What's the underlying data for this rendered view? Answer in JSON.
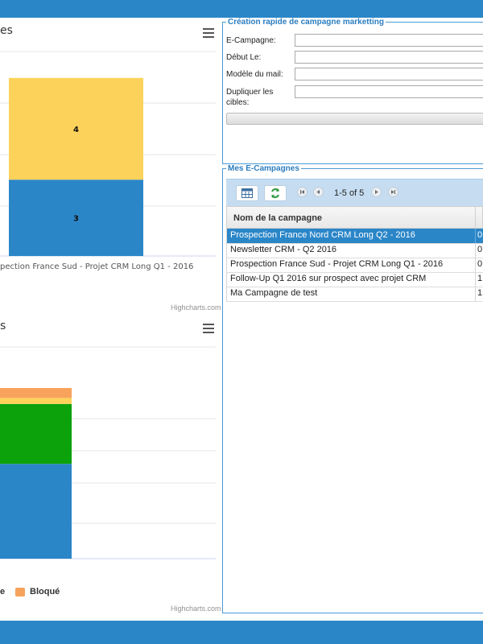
{
  "chart1": {
    "title_fragment": "es",
    "x_label": "pection France Sud - Projet CRM Long Q1 - 2016",
    "credits": "Highcharts.com",
    "menu_icon": "hamburger-menu-icon"
  },
  "chart2": {
    "title_fragment": "s",
    "credits": "Highcharts.com",
    "menu_icon": "hamburger-menu-icon",
    "legend": [
      {
        "label": "e",
        "color": null
      },
      {
        "label": "Bloqué",
        "color": "#f7a35c"
      }
    ]
  },
  "chart_data": [
    {
      "type": "bar",
      "stacked": true,
      "categories": [
        "pection France Sud - Projet CRM Long Q1 - 2016"
      ],
      "series": [
        {
          "values": [
            3
          ],
          "color": "#2b86c8"
        },
        {
          "values": [
            4
          ],
          "color": "#fdd25a"
        }
      ],
      "credits": "Highcharts.com"
    },
    {
      "type": "bar",
      "stacked": true,
      "series": [
        {
          "values": [
            9.5
          ],
          "color": "#2b86c8"
        },
        {
          "values": [
            6
          ],
          "color": "#0ba20b"
        },
        {
          "values": [
            0.6
          ],
          "color": "#fdd25a"
        },
        {
          "name": "Bloqué",
          "values": [
            1
          ],
          "color": "#f7a35c"
        }
      ],
      "credits": "Highcharts.com"
    }
  ],
  "quick_create": {
    "legend": "Création rapide de campagne marketting",
    "fields": [
      {
        "label": "E-Campagne:",
        "value": ""
      },
      {
        "label": "Début Le:",
        "value": ""
      },
      {
        "label": "Modèle du mail:",
        "value": ""
      },
      {
        "label": "Dupliquer les cibles:",
        "value": ""
      }
    ]
  },
  "campaigns": {
    "legend": "Mes E-Campagnes",
    "pager": "1-5 of 5",
    "toolbar_icons": [
      "calendar-grid-icon",
      "refresh-icon"
    ],
    "pager_icons": [
      "first-page-icon",
      "prev-page-icon",
      "next-page-icon",
      "last-page-icon"
    ],
    "column_header": "Nom de la campagne",
    "rows": [
      {
        "name": "Prospection France Nord CRM Long Q2 - 2016",
        "value": "0",
        "selected": true
      },
      {
        "name": "Newsletter CRM - Q2 2016",
        "value": "0",
        "selected": false
      },
      {
        "name": "Prospection France Sud - Projet CRM Long Q1 - 2016",
        "value": "0",
        "selected": false
      },
      {
        "name": "Follow-Up Q1 2016 sur prospect avec projet CRM",
        "value": "1",
        "selected": false
      },
      {
        "name": "Ma Campagne de test",
        "value": "1",
        "selected": false
      }
    ]
  },
  "colors": {
    "header_bar": "#2b86c8",
    "accent": "#2b86c8",
    "fieldset_border": "#4a9ad6"
  }
}
